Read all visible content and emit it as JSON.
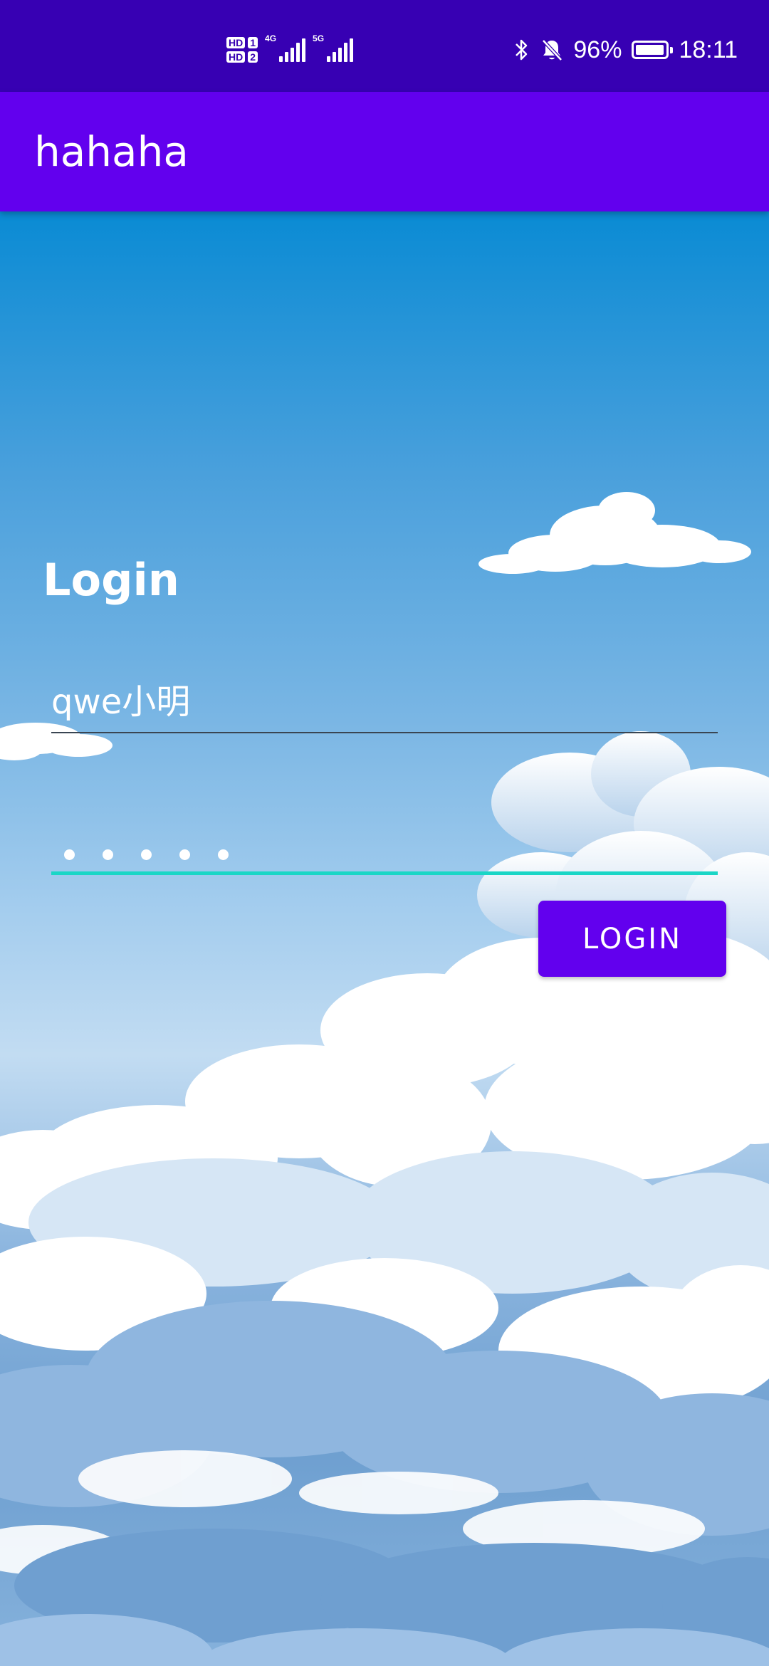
{
  "status_bar": {
    "hd1": "HD",
    "sim1": "1",
    "hd2": "HD",
    "sim2": "2",
    "net1": "4G",
    "net2": "5G",
    "battery_percent": "96%",
    "battery_level": 0.96,
    "time": "18:11",
    "icons": [
      "bluetooth-icon",
      "mute-icon",
      "battery-icon",
      "signal-icon"
    ]
  },
  "app_bar": {
    "title": "hahaha",
    "color": "#6200ee"
  },
  "form": {
    "heading": "Login",
    "username_value": "qwe小明",
    "password_dot_count": 5,
    "login_label": "LOGIN",
    "accent_color": "#1ad6c6"
  }
}
